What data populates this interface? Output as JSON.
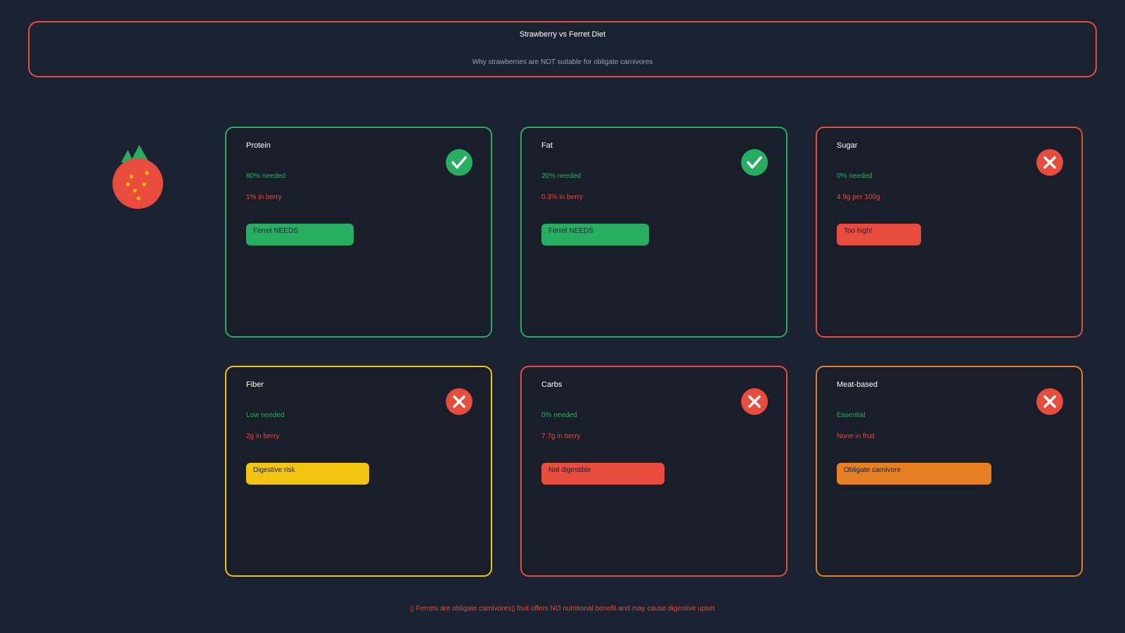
{
  "header": {
    "title": "Strawberry vs Ferret Diet",
    "subtitle": "Why strawberries are NOT suitable for obligate carnivores"
  },
  "colors": {
    "background": "#1b2231",
    "card_background": "#181e2a",
    "good": "#27ae60",
    "bad": "#e74c3c",
    "warning": "#f1c40f",
    "caution": "#e67e22"
  },
  "cards": [
    {
      "name": "Protein",
      "needed": "80% needed",
      "in_berry": "1% in berry",
      "badge": "Ferret NEEDS",
      "status": "check-icon",
      "accent": "#27ae60"
    },
    {
      "name": "Fat",
      "needed": "20% needed",
      "in_berry": "0.3% in berry",
      "badge": "Ferret NEEDS",
      "status": "check-icon",
      "accent": "#27ae60"
    },
    {
      "name": "Sugar",
      "needed": "0% needed",
      "in_berry": "4.9g per 100g",
      "badge": "Too high!",
      "status": "cross-icon",
      "accent": "#e74c3c"
    },
    {
      "name": "Fiber",
      "needed": "Low needed",
      "in_berry": "2g in berry",
      "badge": "Digestive risk",
      "status": "cross-icon",
      "accent": "#f1c40f"
    },
    {
      "name": "Carbs",
      "needed": "0% needed",
      "in_berry": "7.7g in berry",
      "badge": "Not digestible",
      "status": "cross-icon",
      "accent": "#e74c3c"
    },
    {
      "name": "Meat-based",
      "needed": "Essential",
      "in_berry": "None in fruit",
      "badge": "Obligate carnivore",
      "status": "cross-icon",
      "accent": "#e67e22"
    }
  ],
  "footer": {
    "note": "▯ Ferrets are obligate carnivores▯ fruit offers NO nutritional benefit and may cause digestive upset"
  }
}
